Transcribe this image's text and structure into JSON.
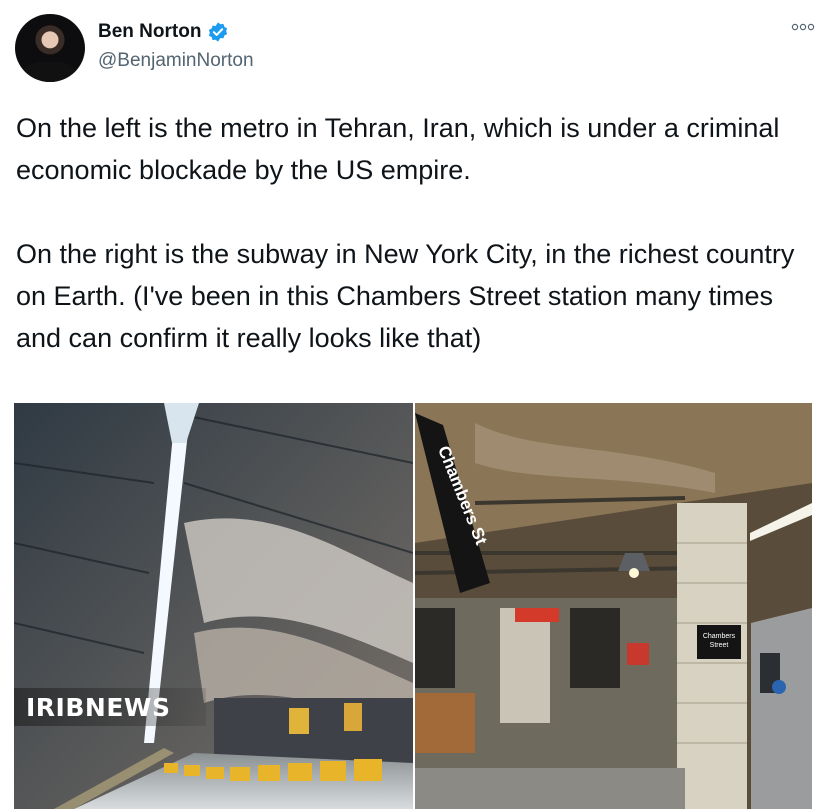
{
  "author": {
    "display_name": "Ben Norton",
    "handle": "@BenjaminNorton",
    "verified": true
  },
  "tweet": {
    "text": "On the left is the metro in Tehran, Iran, which is under a criminal economic blockade by the US empire.\n\nOn the right is the subway in New York City, in the richest country on Earth. (I've been in this Chambers Street station many times and can confirm it really looks like that)"
  },
  "images": {
    "left_alt": "Tehran metro station",
    "right_sign": "Chambers St",
    "right_small_sign": "Chambers Street",
    "watermark": "IRIBNEWS"
  },
  "icons": {
    "more": "more-options-icon",
    "verified": "verified-badge-icon"
  },
  "colors": {
    "verified_blue": "#1d9bf0",
    "handle_gray": "#536471",
    "text": "#0f1419"
  }
}
